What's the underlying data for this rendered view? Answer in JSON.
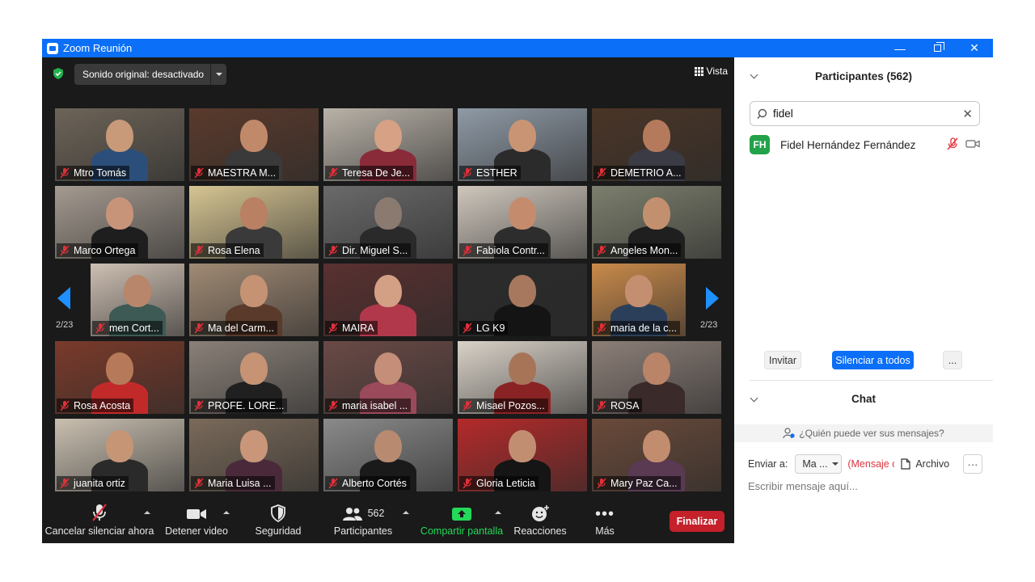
{
  "window": {
    "title": "Zoom Reunión",
    "minimize": "—",
    "close": "✕"
  },
  "meeting": {
    "sound_button": "Sonido original: desactivado",
    "view_button": "Vista",
    "page_left": "2/23",
    "page_right": "2/23",
    "tiles": [
      {
        "name": "Mtro Tomás",
        "bg": "#6d6458",
        "skin": "#c89a7a",
        "cloth": "#2b4f7a"
      },
      {
        "name": "MAESTRA M...",
        "bg": "#5a3a2c",
        "skin": "#c08a6a",
        "cloth": "#3a3a3a"
      },
      {
        "name": "Teresa De Je...",
        "bg": "#b9b2a8",
        "skin": "#d6a184",
        "cloth": "#8a2b3a"
      },
      {
        "name": "ESTHER",
        "bg": "#8f9aa6",
        "skin": "#c99473",
        "cloth": "#2b2b2b"
      },
      {
        "name": "DEMETRIO A...",
        "bg": "#4a3527",
        "skin": "#b57a5c",
        "cloth": "#3b3b45"
      },
      {
        "name": "Marco Ortega",
        "bg": "#a49a90",
        "skin": "#c7947a",
        "cloth": "#1e1e1e"
      },
      {
        "name": "Rosa Elena",
        "bg": "#d6c592",
        "skin": "#b98063",
        "cloth": "#3a3a3a"
      },
      {
        "name": "Dir. Miguel S...",
        "bg": "#6a6a6a",
        "skin": "#8a7a70",
        "cloth": "#2a2a2a"
      },
      {
        "name": "Fabiola Contr...",
        "bg": "#cfc7bd",
        "skin": "#c48c6c",
        "cloth": "#2d2d2d"
      },
      {
        "name": "Angeles Mon...",
        "bg": "#7c7f6d",
        "skin": "#c3906f",
        "cloth": "#1f1f1f"
      },
      {
        "name": "men Cort...",
        "bg": "#cdbfb2",
        "skin": "#b8866b",
        "cloth": "#3d5a55"
      },
      {
        "name": "Ma del Carm...",
        "bg": "#a08a74",
        "skin": "#c59274",
        "cloth": "#5a3a2a"
      },
      {
        "name": "MAIRA",
        "bg": "#5a3030",
        "skin": "#d3a085",
        "cloth": "#b0384a"
      },
      {
        "name": "LG K9",
        "bg": "#2b2b2b",
        "skin": "#a8785e",
        "cloth": "#141414"
      },
      {
        "name": "maria de la c...",
        "bg": "#c98a4a",
        "skin": "#c48e70",
        "cloth": "#2c3f5a"
      },
      {
        "name": "Rosa Acosta",
        "bg": "#7a3a2a",
        "skin": "#b67a5a",
        "cloth": "#c22a2a"
      },
      {
        "name": "PROFE. LORE...",
        "bg": "#8a8078",
        "skin": "#c69474",
        "cloth": "#202020"
      },
      {
        "name": "maria isabel ...",
        "bg": "#6a4a46",
        "skin": "#c58e78",
        "cloth": "#9a4a5a"
      },
      {
        "name": "Misael Pozos...",
        "bg": "#d9d2c8",
        "skin": "#a87458",
        "cloth": "#8a2424"
      },
      {
        "name": "ROSA",
        "bg": "#8c7f78",
        "skin": "#b98468",
        "cloth": "#3a2a2a"
      },
      {
        "name": "juanita ortiz",
        "bg": "#c9bfb0",
        "skin": "#c69576",
        "cloth": "#2a2a2a"
      },
      {
        "name": "Maria Luisa ...",
        "bg": "#7a6a5a",
        "skin": "#c9967a",
        "cloth": "#4a2a3a"
      },
      {
        "name": "Alberto Cortés",
        "bg": "#8a8a8a",
        "skin": "#b88a70",
        "cloth": "#1a1a1a"
      },
      {
        "name": "Gloria Leticia",
        "bg": "#b42a2a",
        "skin": "#c28e72",
        "cloth": "#151515"
      },
      {
        "name": "Mary Paz Ca...",
        "bg": "#6a4a3a",
        "skin": "#c28c6e",
        "cloth": "#5a3a52"
      }
    ]
  },
  "toolbar": {
    "mute": "Cancelar silenciar ahora",
    "video": "Detener video",
    "security": "Seguridad",
    "participants": "Participantes",
    "participants_count": "562",
    "share": "Compartir pantalla",
    "reactions": "Reacciones",
    "more": "Más",
    "end": "Finalizar"
  },
  "participants_panel": {
    "title": "Participantes (562)",
    "search_value": "fidel",
    "participant": {
      "initials": "FH",
      "name": "Fidel Hernández Fernández"
    },
    "invite": "Invitar",
    "mute_all": "Silenciar a todos",
    "more": "..."
  },
  "chat": {
    "title": "Chat",
    "who_sees": "¿Quién puede ver sus mensajes?",
    "send_to_label": "Enviar a:",
    "send_to_value": "Ma ...",
    "send_to_note": "(Mensaje c",
    "file_label": "Archivo",
    "more": "···",
    "placeholder": "Escribir mensaje aquí..."
  },
  "colors": {
    "accent": "#0b6ff7",
    "share_green": "#23d959",
    "end_red": "#c4212b",
    "mute_red": "#e0303a"
  }
}
